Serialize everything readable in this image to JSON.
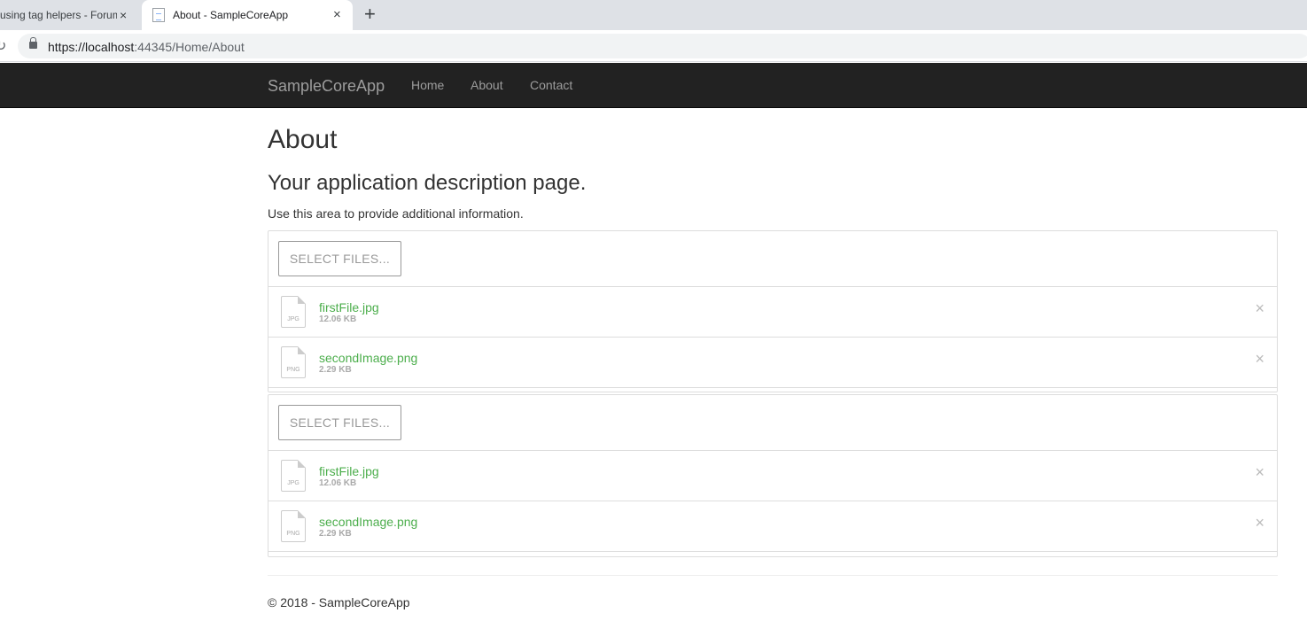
{
  "browser": {
    "tabs": [
      {
        "title": "using tag helpers - Forum"
      },
      {
        "title": "About - SampleCoreApp"
      }
    ],
    "close_glyph": "×",
    "new_tab_glyph": "+",
    "reload_glyph": "↻",
    "url_host": "https://localhost",
    "url_rest": ":44345/Home/About"
  },
  "navbar": {
    "brand": "SampleCoreApp",
    "links": [
      "Home",
      "About",
      "Contact"
    ]
  },
  "page": {
    "title": "About",
    "subtitle": "Your application description page.",
    "description": "Use this area to provide additional information."
  },
  "uploads": [
    {
      "button_label": "SELECT FILES...",
      "files": [
        {
          "name": "firstFile.jpg",
          "size": "12.06 KB",
          "ext": "JPG"
        },
        {
          "name": "secondImage.png",
          "size": "2.29 KB",
          "ext": "PNG"
        }
      ]
    },
    {
      "button_label": "SELECT FILES...",
      "files": [
        {
          "name": "firstFile.jpg",
          "size": "12.06 KB",
          "ext": "JPG"
        },
        {
          "name": "secondImage.png",
          "size": "2.29 KB",
          "ext": "PNG"
        }
      ]
    }
  ],
  "remove_glyph": "×",
  "footer": "© 2018 - SampleCoreApp",
  "colors": {
    "navbar": "#222222",
    "file_name": "#4cae4c"
  }
}
